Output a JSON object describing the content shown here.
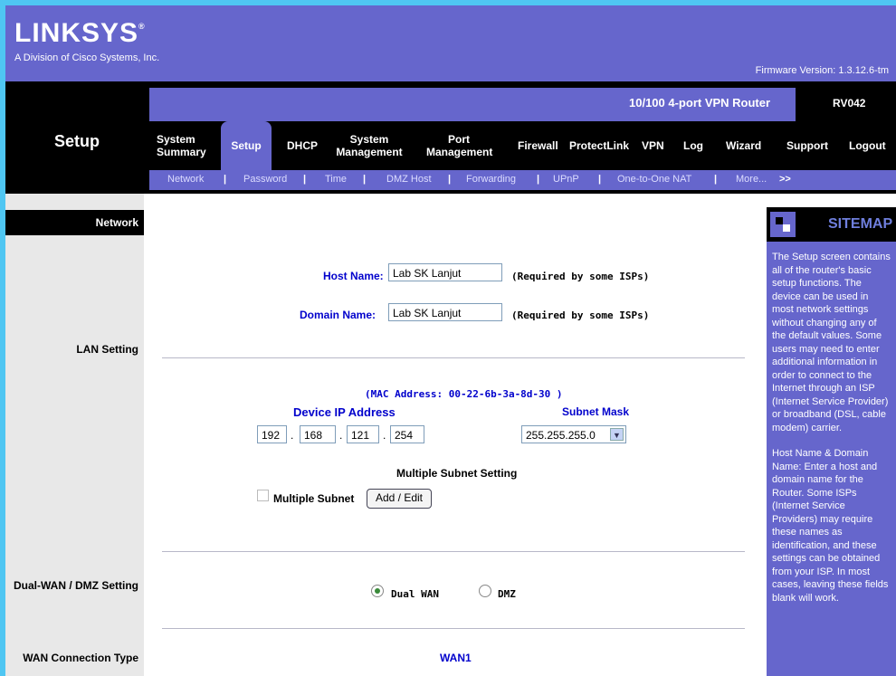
{
  "brand": {
    "logo_text": "LINKSYS",
    "registered": "®",
    "tagline": "A Division of Cisco Systems, Inc.",
    "firmware": "Firmware Version: 1.3.12.6-tm"
  },
  "router": {
    "name": "10/100 4-port VPN Router",
    "model": "RV042"
  },
  "section_title": "Setup",
  "tabs": [
    {
      "label": "System\nSummary"
    },
    {
      "label": "Setup"
    },
    {
      "label": "DHCP"
    },
    {
      "label": "System\nManagement"
    },
    {
      "label": "Port\nManagement"
    },
    {
      "label": "Firewall"
    },
    {
      "label": "ProtectLink"
    },
    {
      "label": "VPN"
    },
    {
      "label": "Log"
    },
    {
      "label": "Wizard"
    },
    {
      "label": "Support"
    },
    {
      "label": "Logout"
    }
  ],
  "subnav": [
    "Network",
    "Password",
    "Time",
    "DMZ Host",
    "Forwarding",
    "UPnP",
    "One-to-One NAT",
    "More...",
    ">>"
  ],
  "left": {
    "network": "Network",
    "lan_setting": "LAN Setting",
    "dual_wan": "Dual-WAN / DMZ Setting",
    "wan_type": "WAN Connection Type"
  },
  "form": {
    "host_name_label": "Host Name:",
    "host_name_value": "Lab SK Lanjut",
    "domain_name_label": "Domain Name:",
    "domain_name_value": "Lab SK Lanjut",
    "required_note": "(Required by some ISPs)",
    "mac_address": "(MAC Address: 00-22-6b-3a-8d-30 )",
    "device_ip_label": "Device IP Address",
    "ip": [
      "192",
      "168",
      "121",
      "254"
    ],
    "subnet_mask_label": "Subnet Mask",
    "subnet_mask_value": "255.255.255.0",
    "multiple_subnet_setting": "Multiple Subnet Setting",
    "multiple_subnet_label": "Multiple Subnet",
    "add_edit_button": "Add / Edit",
    "dual_wan_option": "Dual WAN",
    "dmz_option": "DMZ",
    "wan1_label": "WAN1"
  },
  "sitemap": {
    "title": "SITEMAP",
    "para1": "The Setup screen contains all of the router's basic setup functions. The device can be used in most network settings without changing any of the default values. Some users may need to enter additional information in order to connect to the Internet through an ISP (Internet Service Provider) or broadband (DSL, cable modem) carrier.",
    "para2": "Host Name & Domain Name: Enter a host and domain name for the Router. Some ISPs (Internet Service Providers) may require these names as identification, and these settings can be obtained from your ISP. In most cases, leaving these fields blank will work."
  },
  "colors": {
    "brand_purple": "#6666cc",
    "accent_cyan": "#4fc6f2",
    "label_blue": "#0000cc"
  }
}
